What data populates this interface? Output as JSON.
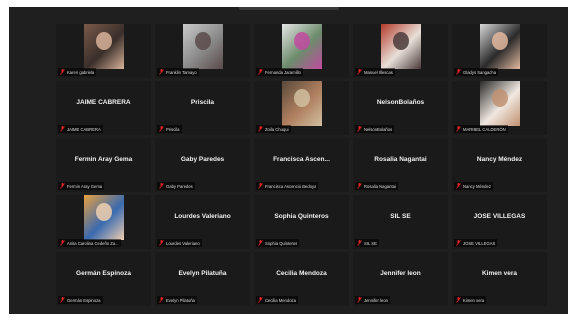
{
  "colors": {
    "mic_muted": "#e02424",
    "tile_bg": "#1a1a1a",
    "frame_bg": "#1f1f1f"
  },
  "icons": {
    "muted": "mic-muted-icon"
  },
  "tiles": [
    {
      "name": "",
      "label": "Karen gabriela",
      "video": true
    },
    {
      "name": "",
      "label": "Franklin Tamayo",
      "video": true
    },
    {
      "name": "",
      "label": "Fernanda Jaramillo",
      "video": true
    },
    {
      "name": "",
      "label": "Manuel Illescas",
      "video": true
    },
    {
      "name": "",
      "label": "Gladys Sangacha",
      "video": true
    },
    {
      "name": "JAIME CABRERA",
      "label": "JAIME CABRERA",
      "video": false
    },
    {
      "name": "Priscila",
      "label": "Priscila",
      "video": false
    },
    {
      "name": "",
      "label": "Zoila Chuqui",
      "video": true
    },
    {
      "name": "NelsonBolaños",
      "label": "NelsonBolaños",
      "video": false
    },
    {
      "name": "",
      "label": "MARIBEL CALDERÓN",
      "video": true
    },
    {
      "name": "Fermin Aray Gema",
      "label": "Fermin Aray Gema",
      "video": false
    },
    {
      "name": "Gaby Paredes",
      "label": "Gaby Paredes",
      "video": false
    },
    {
      "name": "Francisca Ascen...",
      "label": "Francisca Ascencio Bedoya",
      "video": false
    },
    {
      "name": "Rosalia Nagantai",
      "label": "Rosalia Nagantai",
      "video": false
    },
    {
      "name": "Nancy Méndez",
      "label": "Nancy Méndez",
      "video": false
    },
    {
      "name": "",
      "label": "Anita Carolina Cedeño Za...",
      "video": true
    },
    {
      "name": "Lourdes Valeriano",
      "label": "Lourdes Valeriano",
      "video": false
    },
    {
      "name": "Sophia Quinteros",
      "label": "Sophia Quinteros",
      "video": false
    },
    {
      "name": "SIL SE",
      "label": "SIL SE",
      "video": false
    },
    {
      "name": "JOSE VILLEGAS",
      "label": "JOSE VILLEGAS",
      "video": false
    },
    {
      "name": "Germán Espinoza",
      "label": "Germán Espinoza",
      "video": false
    },
    {
      "name": "Evelyn Pilatuña",
      "label": "Evelyn Pilatuña",
      "video": false
    },
    {
      "name": "Cecilia Mendoza",
      "label": "Cecilia Mendoza",
      "video": false
    },
    {
      "name": "Jennifer leon",
      "label": "Jennifer leon",
      "video": false
    },
    {
      "name": "Kimen vera",
      "label": "Kimen vera",
      "video": false
    }
  ]
}
